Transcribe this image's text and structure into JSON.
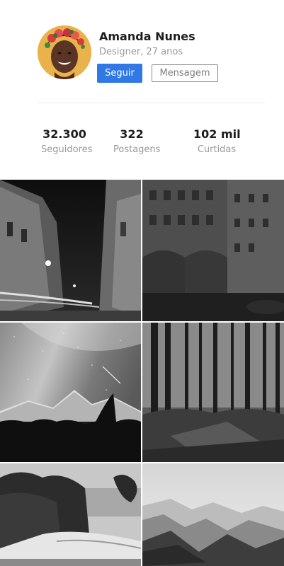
{
  "profile": {
    "name": "Amanda Nunes",
    "subtitle": "Designer, 27 anos",
    "follow_label": "Seguir",
    "message_label": "Mensagem"
  },
  "stats": [
    {
      "value": "32.300",
      "label": "Seguidores"
    },
    {
      "value": "322",
      "label": "Postagens"
    },
    {
      "value": "102 mil",
      "label": "Curtidas"
    }
  ],
  "colors": {
    "accent": "#2f78e6",
    "muted_text": "#9a9a9a",
    "divider": "#ececec"
  },
  "gallery": [
    {
      "subject": "night-street-photo"
    },
    {
      "subject": "city-buildings-photo"
    },
    {
      "subject": "milky-way-mountain-photo"
    },
    {
      "subject": "forest-photo"
    },
    {
      "subject": "coastal-waterfall-photo"
    },
    {
      "subject": "misty-mountains-photo"
    }
  ]
}
